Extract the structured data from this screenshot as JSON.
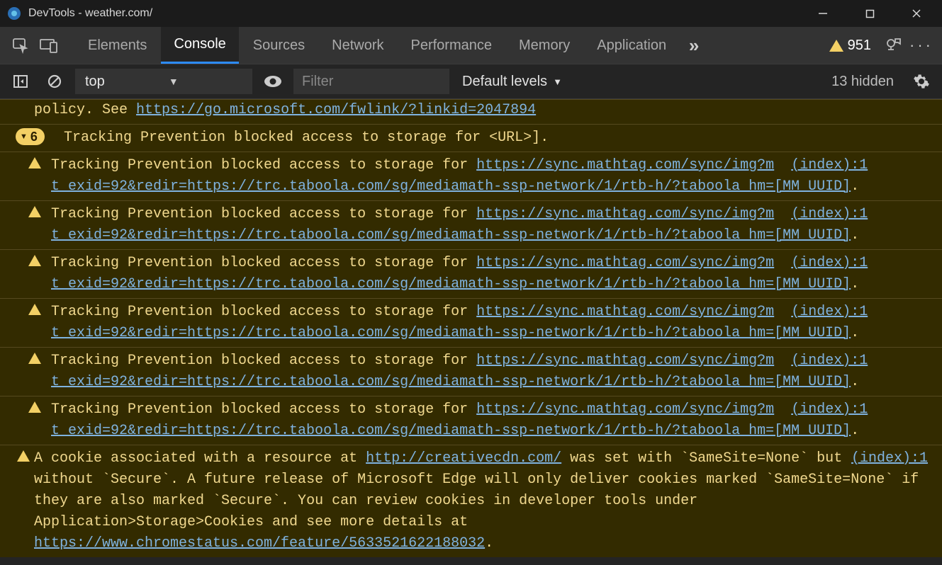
{
  "window": {
    "title": "DevTools - weather.com/"
  },
  "tabs": {
    "elements": "Elements",
    "console": "Console",
    "sources": "Sources",
    "network": "Network",
    "performance": "Performance",
    "memory": "Memory",
    "application": "Application"
  },
  "toolbar": {
    "warning_count": "951",
    "context": "top",
    "filter_placeholder": "Filter",
    "levels": "Default levels",
    "hidden": "13 hidden"
  },
  "messages": {
    "partial_top": {
      "text_tail": "policy. See ",
      "link": "https://go.microsoft.com/fwlink/?linkid=2047894"
    },
    "group": {
      "count": "6",
      "header": "Tracking Prevention blocked access to storage for <URL>]."
    },
    "tracking_prefix": "Tracking Prevention blocked access to storage for ",
    "tracking_url_line1": "https://sync.mathtag.com/sync/img?m",
    "tracking_url_line2": "t_exid=92&redir=https://trc.taboola.com/sg/mediamath-ssp-network/1/rtb-h/?taboola_hm=[MM_UUID]",
    "tracking_suffix": ".",
    "tracking_src": "(index):1",
    "cookie": {
      "t1": "A cookie associated with a resource at ",
      "url1": "http://creativecdn.com/",
      "t2": " was set with `SameSite=None` but without `Secure`. A future release of Microsoft Edge will only deliver cookies marked `SameSite=None` if they are also marked `Secure`. You can review cookies in developer tools under Application>Storage>Cookies and see more details at ",
      "url2": "https://www.chromestatus.com/feature/5633521622188032",
      "t3": ".",
      "src": "(index):1"
    }
  }
}
